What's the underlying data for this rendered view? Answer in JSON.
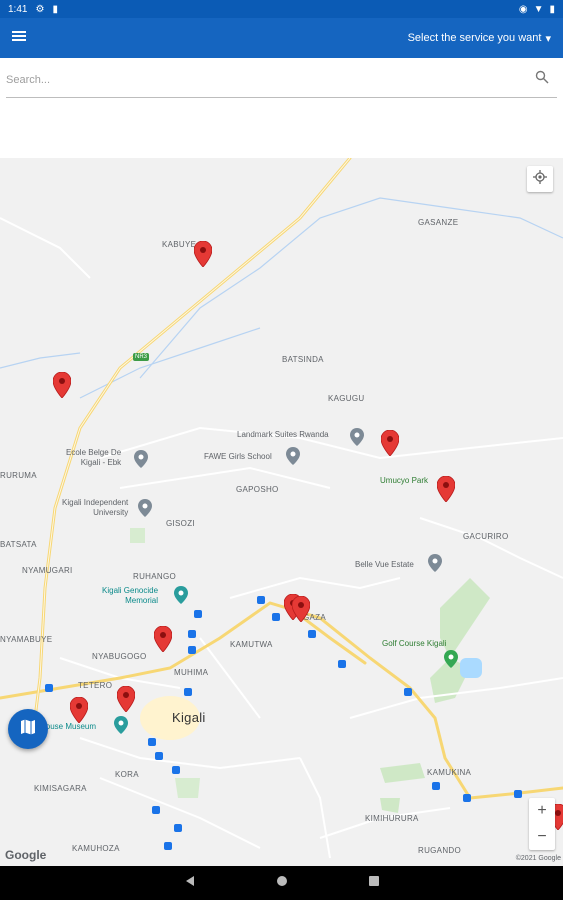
{
  "status_bar": {
    "time": "1:41"
  },
  "app_bar": {
    "service_label": "Select the service you want",
    "menu_icon": "menu-icon"
  },
  "search": {
    "placeholder": "Search..."
  },
  "map": {
    "places": {
      "kabuye": "KABUYE",
      "gasanze": "GASANZE",
      "batsinda": "BATSINDA",
      "kagugu": "KAGUGU",
      "ruruma": "RURUMA",
      "gaposho": "GAPOSHO",
      "gisozi": "GISOZI",
      "gacuriro": "GACURIRO",
      "batsata": "BATSATA",
      "nyamugari": "NYAMUGARI",
      "ruhango": "RUHANGO",
      "nyamabuye": "NYAMABUYE",
      "nyabugogo": "NYABUGOGO",
      "muhima": "MUHIMA",
      "kamutwa": "KAMUTWA",
      "kimihurura": "KIMIHURURA",
      "tetero": "TETERO",
      "kigali": "Kigali",
      "kora": "KORA",
      "kimisagara": "KIMISAGARA",
      "kamukina": "KAMUKINA",
      "kamuhoza": "KAMUHOZA",
      "rugando": "RUGANDO",
      "gaza": "GAZA"
    },
    "pois": {
      "landmark": "Landmark Suites Rwanda",
      "ecole": "Ecole Belge De\nKigali - Ebk",
      "fawe": "FAWE Girls School",
      "umucyo": "Umucyo Park",
      "kiu": "Kigali Independent\nUniversity",
      "bellevue": "Belle Vue Estate",
      "genocide": "Kigali Genocide\nMemorial",
      "golf": "Golf Course Kigali",
      "house_museum": "House Museum"
    },
    "google_label": "Google",
    "copyright": "©2021 Google",
    "road_badge": "NR3"
  },
  "controls": {
    "zoom_in": "+",
    "zoom_out": "−"
  }
}
